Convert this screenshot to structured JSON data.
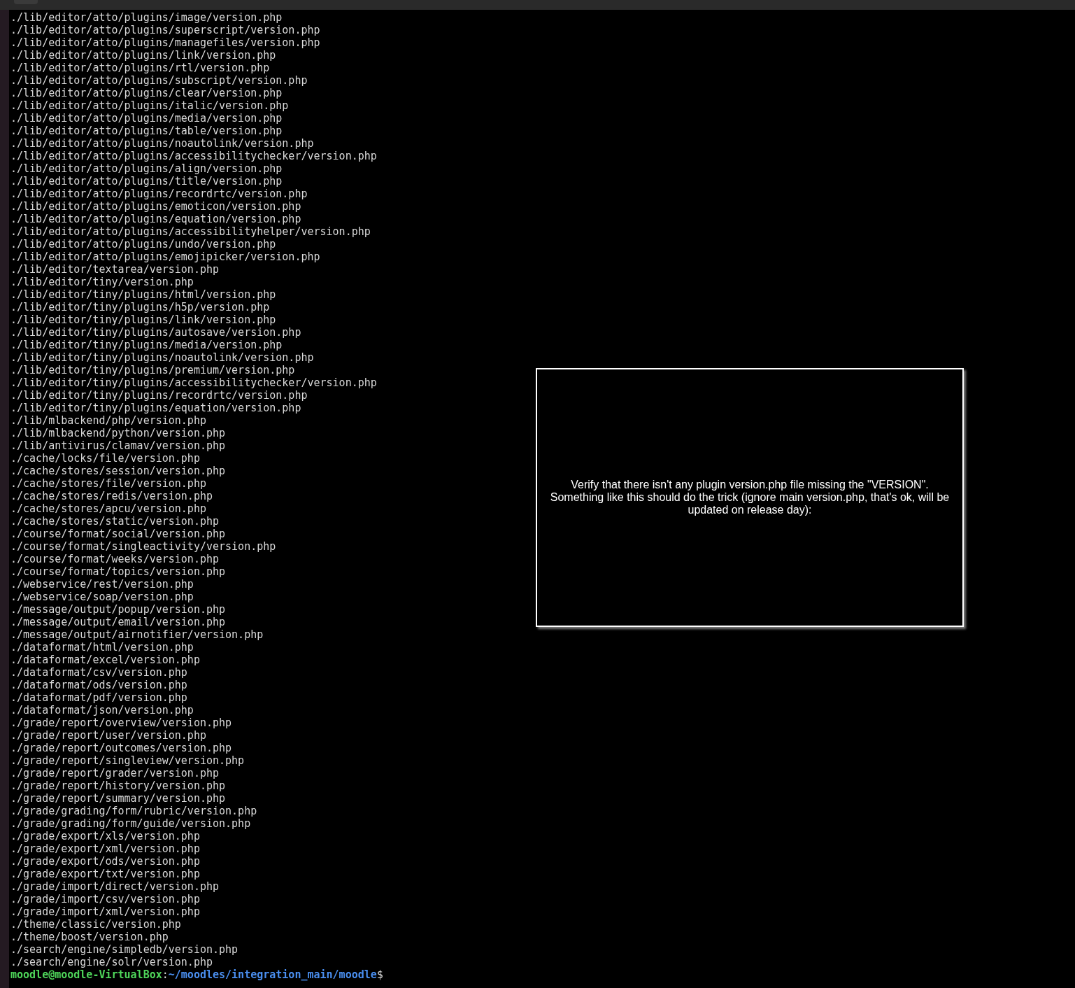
{
  "terminal": {
    "lines": [
      "./lib/editor/atto/plugins/image/version.php",
      "./lib/editor/atto/plugins/superscript/version.php",
      "./lib/editor/atto/plugins/managefiles/version.php",
      "./lib/editor/atto/plugins/link/version.php",
      "./lib/editor/atto/plugins/rtl/version.php",
      "./lib/editor/atto/plugins/subscript/version.php",
      "./lib/editor/atto/plugins/clear/version.php",
      "./lib/editor/atto/plugins/italic/version.php",
      "./lib/editor/atto/plugins/media/version.php",
      "./lib/editor/atto/plugins/table/version.php",
      "./lib/editor/atto/plugins/noautolink/version.php",
      "./lib/editor/atto/plugins/accessibilitychecker/version.php",
      "./lib/editor/atto/plugins/align/version.php",
      "./lib/editor/atto/plugins/title/version.php",
      "./lib/editor/atto/plugins/recordrtc/version.php",
      "./lib/editor/atto/plugins/emoticon/version.php",
      "./lib/editor/atto/plugins/equation/version.php",
      "./lib/editor/atto/plugins/accessibilityhelper/version.php",
      "./lib/editor/atto/plugins/undo/version.php",
      "./lib/editor/atto/plugins/emojipicker/version.php",
      "./lib/editor/textarea/version.php",
      "./lib/editor/tiny/version.php",
      "./lib/editor/tiny/plugins/html/version.php",
      "./lib/editor/tiny/plugins/h5p/version.php",
      "./lib/editor/tiny/plugins/link/version.php",
      "./lib/editor/tiny/plugins/autosave/version.php",
      "./lib/editor/tiny/plugins/media/version.php",
      "./lib/editor/tiny/plugins/noautolink/version.php",
      "./lib/editor/tiny/plugins/premium/version.php",
      "./lib/editor/tiny/plugins/accessibilitychecker/version.php",
      "./lib/editor/tiny/plugins/recordrtc/version.php",
      "./lib/editor/tiny/plugins/equation/version.php",
      "./lib/mlbackend/php/version.php",
      "./lib/mlbackend/python/version.php",
      "./lib/antivirus/clamav/version.php",
      "./cache/locks/file/version.php",
      "./cache/stores/session/version.php",
      "./cache/stores/file/version.php",
      "./cache/stores/redis/version.php",
      "./cache/stores/apcu/version.php",
      "./cache/stores/static/version.php",
      "./course/format/social/version.php",
      "./course/format/singleactivity/version.php",
      "./course/format/weeks/version.php",
      "./course/format/topics/version.php",
      "./webservice/rest/version.php",
      "./webservice/soap/version.php",
      "./message/output/popup/version.php",
      "./message/output/email/version.php",
      "./message/output/airnotifier/version.php",
      "./dataformat/html/version.php",
      "./dataformat/excel/version.php",
      "./dataformat/csv/version.php",
      "./dataformat/ods/version.php",
      "./dataformat/pdf/version.php",
      "./dataformat/json/version.php",
      "./grade/report/overview/version.php",
      "./grade/report/user/version.php",
      "./grade/report/outcomes/version.php",
      "./grade/report/singleview/version.php",
      "./grade/report/grader/version.php",
      "./grade/report/history/version.php",
      "./grade/report/summary/version.php",
      "./grade/grading/form/rubric/version.php",
      "./grade/grading/form/guide/version.php",
      "./grade/export/xls/version.php",
      "./grade/export/xml/version.php",
      "./grade/export/ods/version.php",
      "./grade/export/txt/version.php",
      "./grade/import/direct/version.php",
      "./grade/import/csv/version.php",
      "./grade/import/xml/version.php",
      "./theme/classic/version.php",
      "./theme/boost/version.php",
      "./search/engine/simpledb/version.php",
      "./search/engine/solr/version.php"
    ],
    "prompt": {
      "user_host": "moodle@moodle-VirtualBox",
      "separator": ":",
      "path": "~/moodles/integration_main/moodle",
      "symbol": "$"
    }
  },
  "note": {
    "text": "Verify that there isn't any plugin version.php file missing the \"VERSION\". Something like this should do the trick (ignore main version.php, that's ok, will be updated on release day):"
  }
}
